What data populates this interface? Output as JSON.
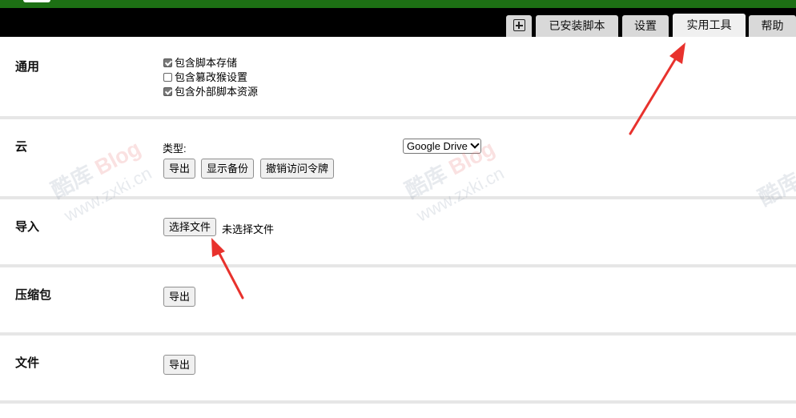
{
  "tabs": [
    {
      "label": "已安装脚本"
    },
    {
      "label": "设置"
    },
    {
      "label": "实用工具",
      "active": true
    },
    {
      "label": "帮助"
    }
  ],
  "sections": {
    "general": {
      "title": "通用",
      "options": [
        {
          "label": "包含脚本存储",
          "checked": true
        },
        {
          "label": "包含篡改猴设置",
          "checked": false
        },
        {
          "label": "包含外部脚本资源",
          "checked": true
        }
      ]
    },
    "cloud": {
      "title": "云",
      "type_label": "类型:",
      "type_value": "Google Drive",
      "buttons": {
        "export": "导出",
        "show_backups": "显示备份",
        "revoke": "撤销访问令牌"
      }
    },
    "import": {
      "title": "导入",
      "choose_file": "选择文件",
      "no_file": "未选择文件"
    },
    "zip": {
      "title": "压缩包",
      "export": "导出"
    },
    "file": {
      "title": "文件",
      "export": "导出"
    }
  },
  "watermark": {
    "site": "酷库",
    "blog": "Blog",
    "url": "www.zxki.cn"
  },
  "colors": {
    "header_green": "#1d7014",
    "arrow": "#e8322d"
  }
}
